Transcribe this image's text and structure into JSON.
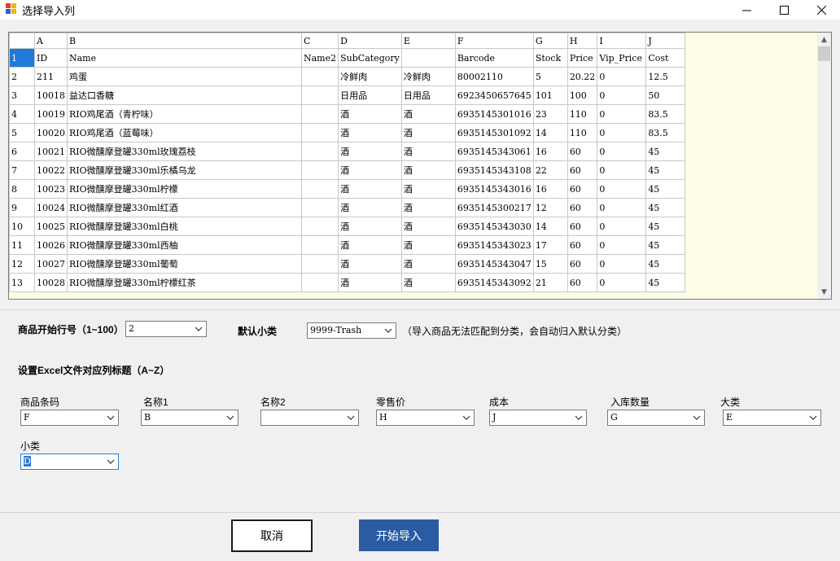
{
  "window": {
    "title": "选择导入列",
    "minimize_glyph": "—",
    "maximize_glyph": "☐",
    "close_glyph": "✕"
  },
  "grid": {
    "col_letters": [
      "",
      "A",
      "B",
      "C",
      "D",
      "E",
      "F",
      "G",
      "H",
      "I",
      "J"
    ],
    "rows": [
      [
        "1",
        "ID",
        "Name",
        "Name2",
        "SubCategory",
        "",
        "Barcode",
        "Stock",
        "Price",
        "Vip_Price",
        "Cost"
      ],
      [
        "2",
        "211",
        "鸡蛋",
        "",
        "冷鲜肉",
        "冷鲜肉",
        "80002110",
        "5",
        "20.22",
        "0",
        "12.5"
      ],
      [
        "3",
        "10018",
        "益达口香糖",
        "",
        "日用品",
        "日用品",
        "6923450657645",
        "101",
        "100",
        "0",
        "50"
      ],
      [
        "4",
        "10019",
        "RIO鸡尾酒（青柠味）",
        "",
        "酒",
        "酒",
        "6935145301016",
        "23",
        "110",
        "0",
        "83.5"
      ],
      [
        "5",
        "10020",
        "RIO鸡尾酒（蓝莓味）",
        "",
        "酒",
        "酒",
        "6935145301092",
        "14",
        "110",
        "0",
        "83.5"
      ],
      [
        "6",
        "10021",
        "RIO微醺摩登罐330ml玫瑰荔枝",
        "",
        "酒",
        "酒",
        "6935145343061",
        "16",
        "60",
        "0",
        "45"
      ],
      [
        "7",
        "10022",
        "RIO微醺摩登罐330ml乐橘乌龙",
        "",
        "酒",
        "酒",
        "6935145343108",
        "22",
        "60",
        "0",
        "45"
      ],
      [
        "8",
        "10023",
        "RIO微醺摩登罐330ml柠檬",
        "",
        "酒",
        "酒",
        "6935145343016",
        "16",
        "60",
        "0",
        "45"
      ],
      [
        "9",
        "10024",
        "RIO微醺摩登罐330ml红酒",
        "",
        "酒",
        "酒",
        "6935145300217",
        "12",
        "60",
        "0",
        "45"
      ],
      [
        "10",
        "10025",
        "RIO微醺摩登罐330ml白桃",
        "",
        "酒",
        "酒",
        "6935145343030",
        "14",
        "60",
        "0",
        "45"
      ],
      [
        "11",
        "10026",
        "RIO微醺摩登罐330ml西柚",
        "",
        "酒",
        "酒",
        "6935145343023",
        "17",
        "60",
        "0",
        "45"
      ],
      [
        "12",
        "10027",
        "RIO微醺摩登罐330ml葡萄",
        "",
        "酒",
        "酒",
        "6935145343047",
        "15",
        "60",
        "0",
        "45"
      ],
      [
        "13",
        "10028",
        "RIO微醺摩登罐330ml柠檬红茶",
        "",
        "酒",
        "酒",
        "6935145343092",
        "21",
        "60",
        "0",
        "45"
      ]
    ]
  },
  "settings": {
    "start_row_label": "商品开始行号（1~100）",
    "start_row_value": "2",
    "default_sub_label": "默认小类",
    "default_sub_value": "9999-Trash",
    "default_sub_hint": "（导入商品无法匹配到分类，会自动归入默认分类）",
    "mapping_title": "设置Excel文件对应列标题（A~Z）"
  },
  "mapping": [
    {
      "label": "商品条码",
      "value": "F"
    },
    {
      "label": "名称1",
      "value": "B"
    },
    {
      "label": "名称2",
      "value": ""
    },
    {
      "label": "零售价",
      "value": "H"
    },
    {
      "label": "成本",
      "value": "J"
    },
    {
      "label": "入库数量",
      "value": "G"
    },
    {
      "label": "大类",
      "value": "E"
    }
  ],
  "mapping2": {
    "label": "小类",
    "value": "D"
  },
  "buttons": {
    "cancel": "取消",
    "start": "开始导入"
  }
}
